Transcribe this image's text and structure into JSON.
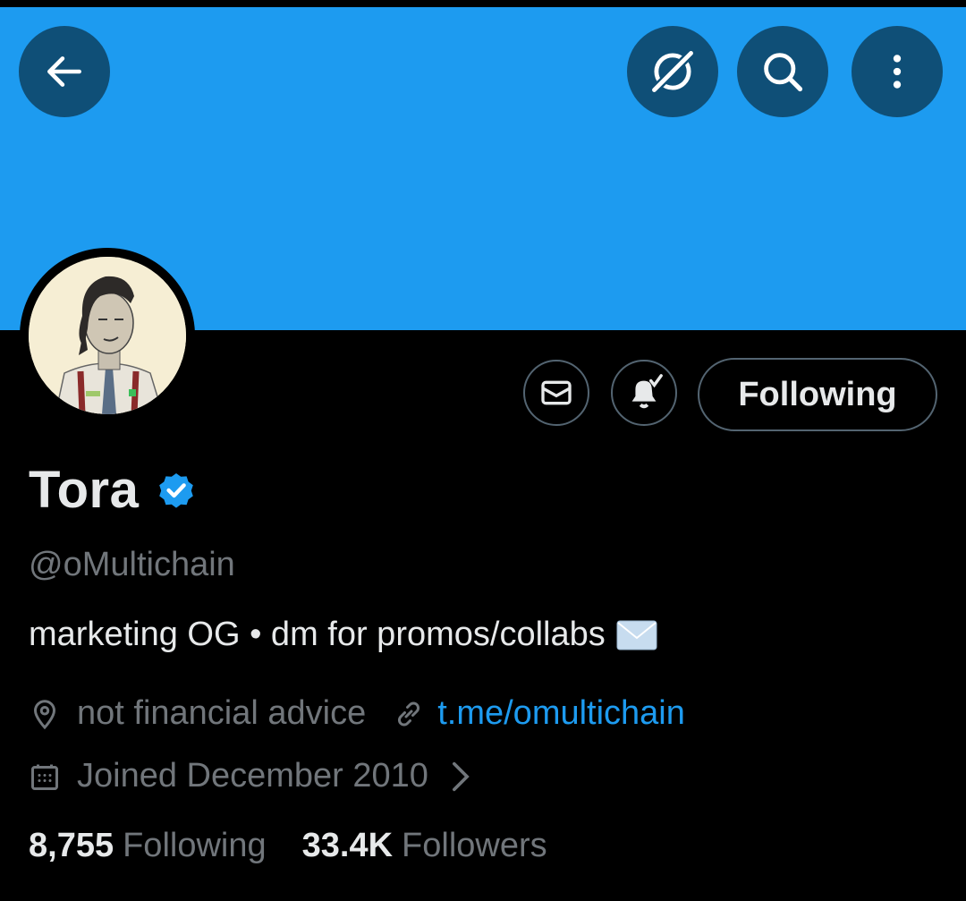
{
  "header": {
    "back_icon": "arrow-left-icon",
    "grok_icon": "grok-icon",
    "search_icon": "search-icon",
    "more_icon": "more-vertical-icon",
    "banner_color": "#1d9bf0"
  },
  "profile": {
    "name": "Tora",
    "handle": "@oMultichain",
    "bio": "marketing OG • dm for promos/collabs",
    "bio_emoji": "envelope-emoji",
    "location": "not financial advice",
    "website": "t.me/omultichain",
    "joined": "Joined December 2010",
    "verified": true
  },
  "actions": {
    "message_icon": "mail-icon",
    "notify_icon": "bell-check-icon",
    "follow_label": "Following"
  },
  "stats": {
    "following_count": "8,755",
    "following_label": "Following",
    "followers_count": "33.4K",
    "followers_label": "Followers"
  },
  "colors": {
    "accent": "#1d9bf0",
    "muted": "#71767b",
    "text": "#e7e9ea"
  }
}
